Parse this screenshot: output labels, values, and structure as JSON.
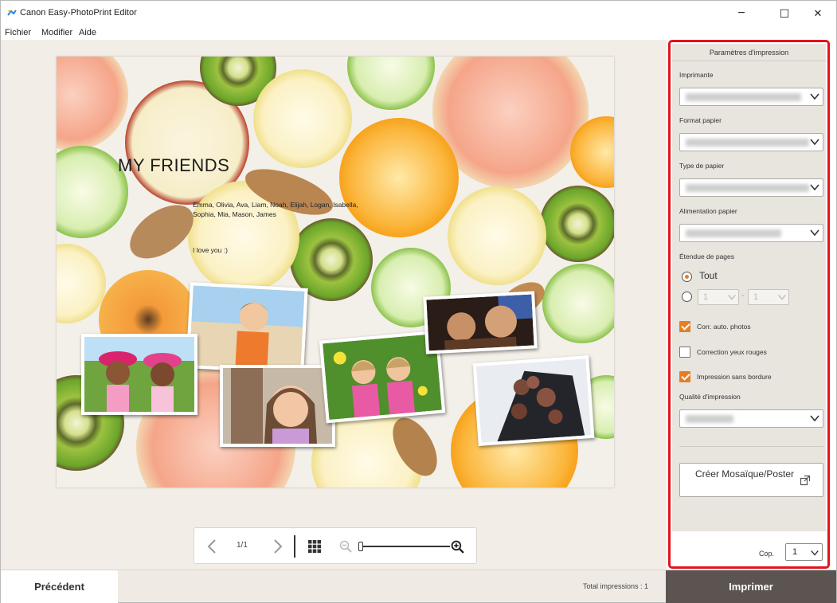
{
  "window": {
    "title": "Canon Easy-PhotoPrint Editor",
    "controls": {
      "minimize": "−",
      "maximize": "☐",
      "close": "✕"
    }
  },
  "menu": [
    "Fichier",
    "Modifier",
    "Aide"
  ],
  "page": {
    "title": "MY FRIENDS",
    "names": "Emma, Olivia, Ava, Liam, Noah, Elijah, Logan, Isabella, Sophia, Mia, Mason, James",
    "message": "I love you :)"
  },
  "navigation": {
    "page_indicator": "1/1",
    "prev_icon": "chevron-left-icon",
    "next_icon": "chevron-right-icon",
    "grid_icon": "grid-icon",
    "zoom_level": 0
  },
  "panel": {
    "header": "Paramètres d'impression",
    "printer_label": "Imprimante",
    "paper_size_label": "Format papier",
    "paper_type_label": "Type de papier",
    "paper_source_label": "Alimentation papier",
    "page_range_label": "Étendue de pages",
    "range_all": "Tout",
    "range_from": "1",
    "range_dash": "-",
    "range_to": "1",
    "auto_photo_fix": "Corr. auto. photos",
    "red_eye": "Correction yeux rouges",
    "borderless": "Impression sans bordure",
    "quality_label": "Qualité d'impression",
    "mosaic_button": "Créer Mosaïque/Poster",
    "copies_label": "Cop.",
    "copies_value": "1",
    "checks": {
      "auto_photo_fix": true,
      "red_eye": false,
      "borderless": true
    },
    "accent_color": "#e67e22",
    "highlight_color": "#e0141e"
  },
  "bottom": {
    "previous": "Précédent",
    "total_prints": "Total impressions : 1",
    "print": "Imprimer"
  }
}
